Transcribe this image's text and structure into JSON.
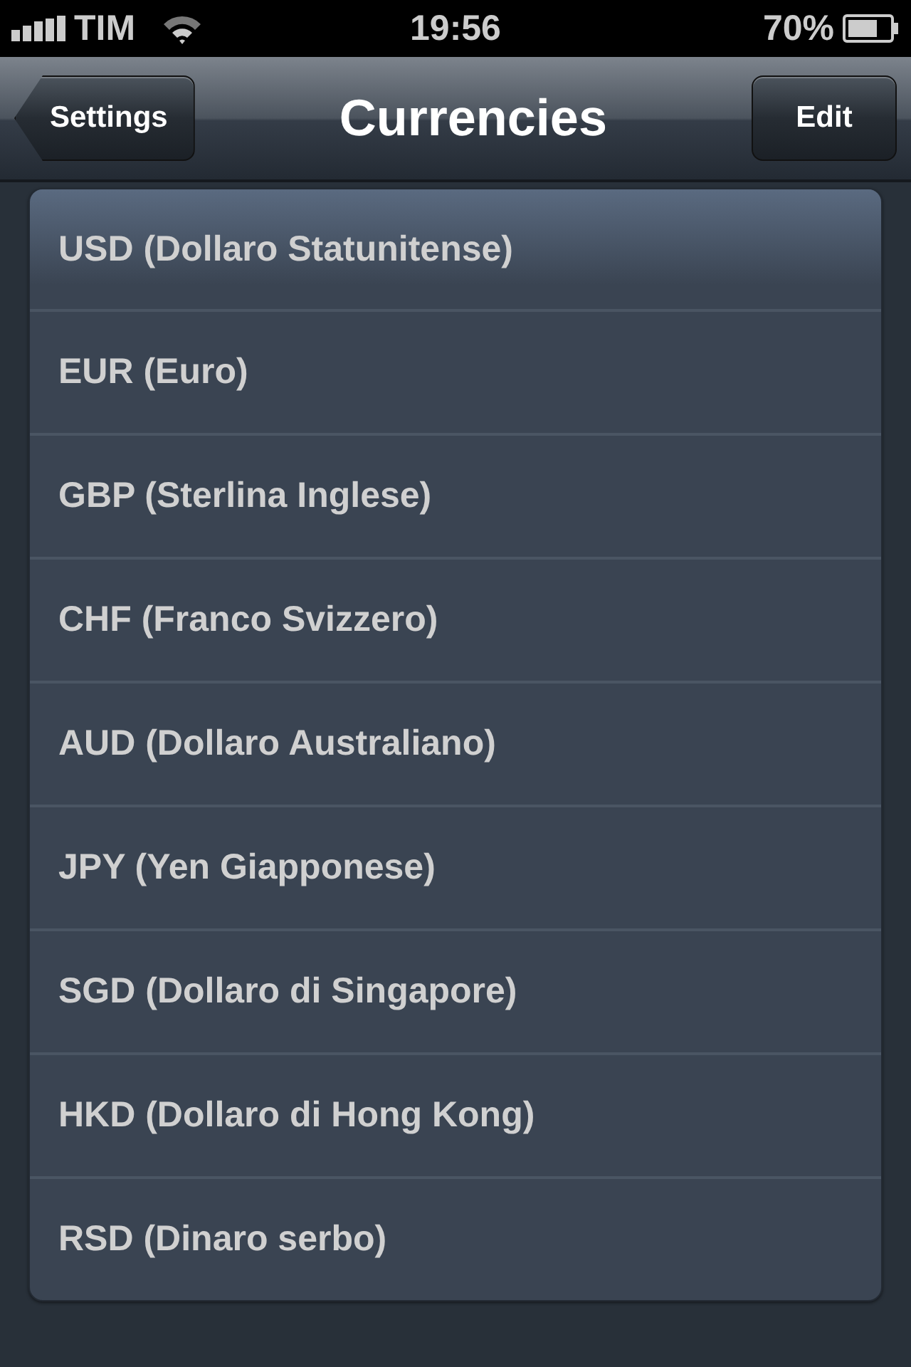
{
  "status_bar": {
    "carrier": "TIM",
    "time": "19:56",
    "battery": "70%"
  },
  "nav_bar": {
    "back_button": "Settings",
    "title": "Currencies",
    "edit_button": "Edit"
  },
  "currencies": [
    {
      "label": "USD (Dollaro Statunitense)"
    },
    {
      "label": "EUR (Euro)"
    },
    {
      "label": "GBP (Sterlina Inglese)"
    },
    {
      "label": "CHF (Franco Svizzero)"
    },
    {
      "label": "AUD (Dollaro Australiano)"
    },
    {
      "label": "JPY (Yen Giapponese)"
    },
    {
      "label": "SGD (Dollaro di Singapore)"
    },
    {
      "label": "HKD (Dollaro di Hong Kong)"
    },
    {
      "label": "RSD (Dinaro serbo)"
    }
  ]
}
